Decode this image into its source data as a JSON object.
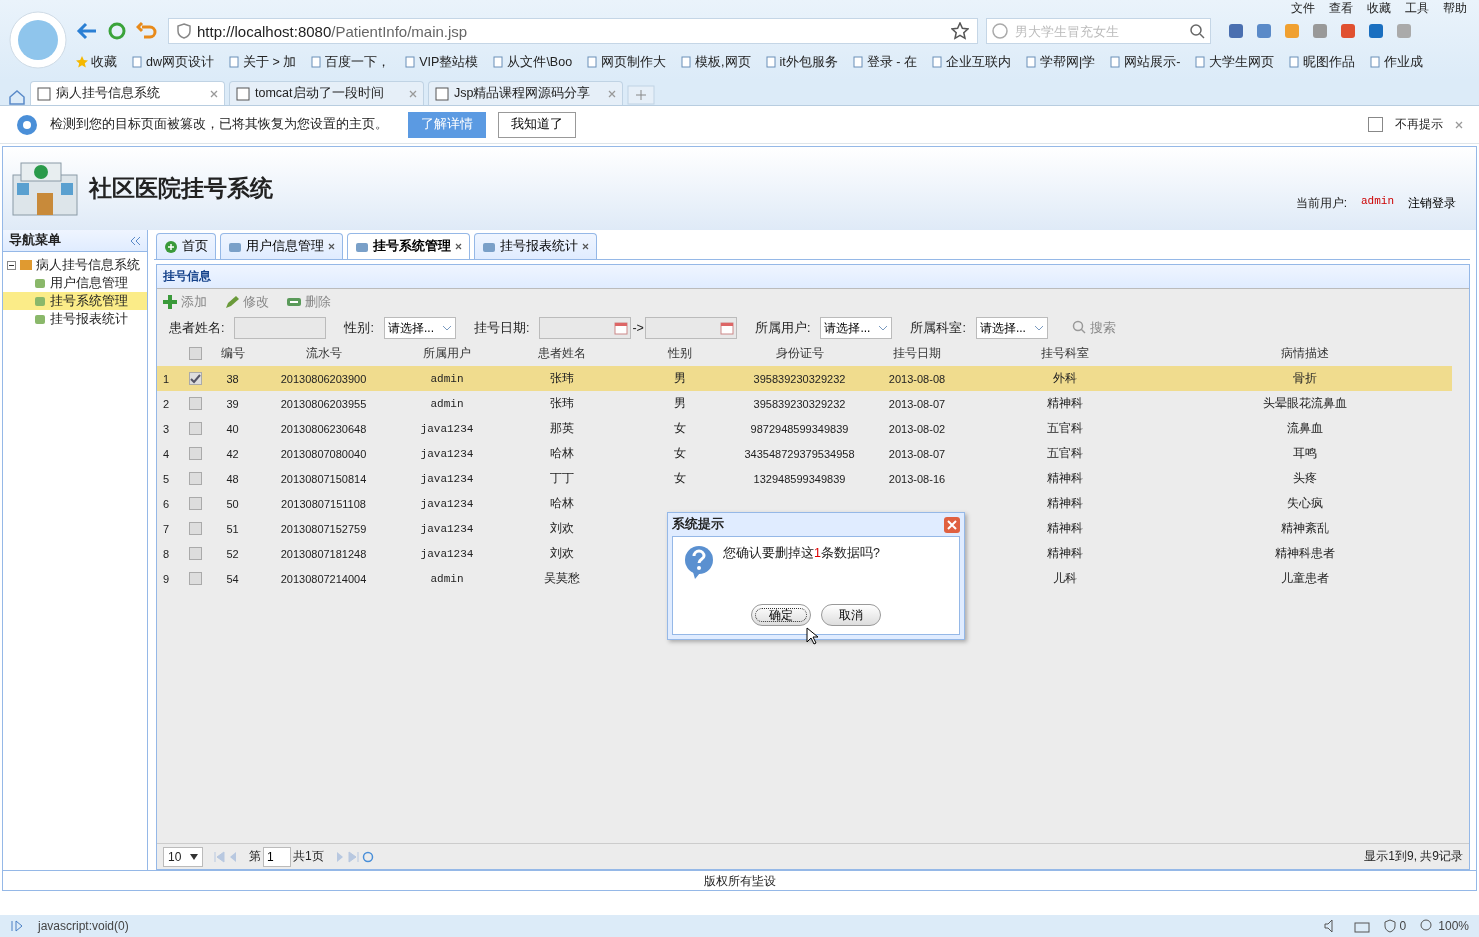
{
  "browser": {
    "menu": [
      "文件",
      "查看",
      "收藏",
      "工具",
      "帮助"
    ],
    "url": {
      "host": "http://localhost:8080",
      "path": "/PatientInfo/main.jsp"
    },
    "search": {
      "placeholder": "男大学生冒充女生"
    },
    "bookmarks": [
      {
        "label": "收藏"
      },
      {
        "label": "dw网页设计"
      },
      {
        "label": "关于 > 加"
      },
      {
        "label": "百度一下，"
      },
      {
        "label": "VIP整站模"
      },
      {
        "label": "从文件\\Boo"
      },
      {
        "label": "网页制作大"
      },
      {
        "label": "模板,网页"
      },
      {
        "label": "it外包服务"
      },
      {
        "label": "登录 - 在"
      },
      {
        "label": "企业互联内"
      },
      {
        "label": "学帮网|学"
      },
      {
        "label": "网站展示-"
      },
      {
        "label": "大学生网页"
      },
      {
        "label": "昵图作品"
      },
      {
        "label": "作业成"
      }
    ],
    "tabs": [
      {
        "label": "病人挂号信息系统",
        "selected": true
      },
      {
        "label": "tomcat启动了一段时间",
        "selected": false
      },
      {
        "label": "Jsp精品课程网源码分享",
        "selected": false
      }
    ],
    "notice": {
      "text": "检测到您的目标页面被篡改，已将其恢复为您设置的主页。",
      "buttons": [
        "了解详情",
        "我知道了"
      ],
      "dismiss": {
        "label": "不再提示",
        "checked": false
      }
    }
  },
  "app": {
    "title": "社区医院挂号系统",
    "user_label": "当前用户:",
    "user": "admin",
    "logout": "注销登录",
    "nav": {
      "title": "导航菜单",
      "tree": [
        {
          "label": "病人挂号信息系统",
          "expanded": true,
          "children": [
            {
              "label": "用户信息管理",
              "selected": false
            },
            {
              "label": "挂号系统管理",
              "selected": true
            },
            {
              "label": "挂号报表统计",
              "selected": false
            }
          ]
        }
      ]
    },
    "tabs": [
      {
        "label": "首页",
        "selected": false,
        "closable": false
      },
      {
        "label": "用户信息管理",
        "selected": false,
        "closable": true
      },
      {
        "label": "挂号系统管理",
        "selected": true,
        "closable": true
      },
      {
        "label": "挂号报表统计",
        "selected": false,
        "closable": true
      }
    ],
    "panel_title": "挂号信息",
    "toolbar": [
      "添加",
      "修改",
      "删除"
    ],
    "filters": [
      {
        "kind": "text",
        "label": "患者姓名:"
      },
      {
        "kind": "select",
        "label": "性别:",
        "placeholder": "请选择..."
      },
      {
        "kind": "daterange",
        "label": "挂号日期:",
        "separator": "->"
      },
      {
        "kind": "select",
        "label": "所属用户:",
        "placeholder": "请选择..."
      },
      {
        "kind": "select",
        "label": "所属科室:",
        "placeholder": "请选择..."
      }
    ],
    "search_button": "搜索",
    "table": {
      "all_checked": false,
      "columns": [
        "编号",
        "流水号",
        "所属用户",
        "患者姓名",
        "性别",
        "身份证号",
        "挂号日期",
        "挂号科室",
        "病情描述"
      ],
      "rows": [
        {
          "n": "1",
          "checked": true,
          "selected": true,
          "cells": [
            "38",
            "20130806203900",
            "admin",
            "张玮",
            "男",
            "395839230329232",
            "2013-08-08",
            "外科",
            "骨折"
          ]
        },
        {
          "n": "2",
          "checked": false,
          "selected": false,
          "cells": [
            "39",
            "20130806203955",
            "admin",
            "张玮",
            "男",
            "395839230329232",
            "2013-08-07",
            "精神科",
            "头晕眼花流鼻血"
          ]
        },
        {
          "n": "3",
          "checked": false,
          "selected": false,
          "cells": [
            "40",
            "20130806230648",
            "java1234",
            "那英",
            "女",
            "9872948599349839",
            "2013-08-02",
            "五官科",
            "流鼻血"
          ]
        },
        {
          "n": "4",
          "checked": false,
          "selected": false,
          "cells": [
            "42",
            "20130807080040",
            "java1234",
            "哈林",
            "女",
            "343548729379534958",
            "2013-08-07",
            "五官科",
            "耳鸣"
          ]
        },
        {
          "n": "5",
          "checked": false,
          "selected": false,
          "cells": [
            "48",
            "20130807150814",
            "java1234",
            "丁丁",
            "女",
            "132948599349839",
            "2013-08-16",
            "精神科",
            "头疼"
          ]
        },
        {
          "n": "6",
          "checked": false,
          "selected": false,
          "cells": [
            "50",
            "20130807151108",
            "java1234",
            "哈林",
            null,
            null,
            null,
            "精神科",
            "失心疯"
          ]
        },
        {
          "n": "7",
          "checked": false,
          "selected": false,
          "cells": [
            "51",
            "20130807152759",
            "java1234",
            "刘欢",
            null,
            null,
            null,
            "精神科",
            "精神紊乱"
          ]
        },
        {
          "n": "8",
          "checked": false,
          "selected": false,
          "cells": [
            "52",
            "20130807181248",
            "java1234",
            "刘欢",
            null,
            null,
            null,
            "精神科",
            "精神科患者"
          ]
        },
        {
          "n": "9",
          "checked": false,
          "selected": false,
          "cells": [
            "54",
            "20130807214004",
            "admin",
            "吴莫愁",
            null,
            null,
            null,
            "儿科",
            "儿童患者"
          ]
        }
      ]
    },
    "pager": {
      "page_size": "10",
      "page_before": "第",
      "page": "1",
      "page_after": "共1页",
      "summary": "显示1到9, 共9记录"
    },
    "footer": "版权所有坒设",
    "dialog": {
      "title": "系统提示",
      "text_before": "您确认要删掉这",
      "count": "1",
      "text_after": "条数据吗?",
      "buttons": [
        "确定",
        "取消"
      ]
    }
  },
  "status_bar": {
    "text": "javascript:void(0)",
    "count": "0",
    "zoom": "100%"
  }
}
